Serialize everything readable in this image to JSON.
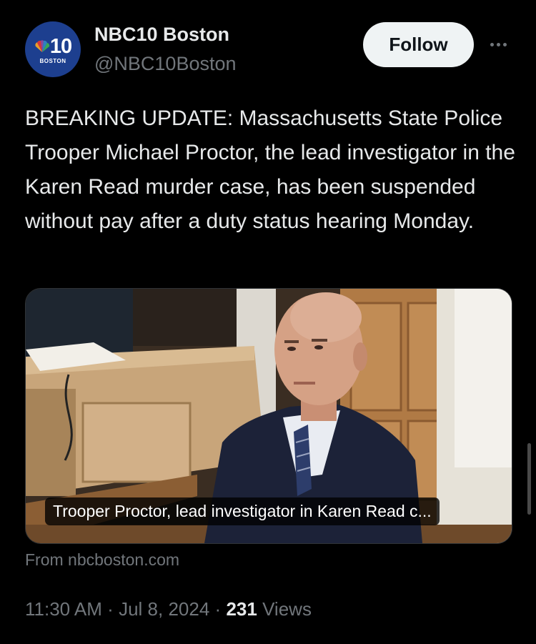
{
  "author": {
    "name": "NBC10 Boston",
    "handle": "@NBC10Boston",
    "avatar": {
      "logo_number": "10",
      "logo_city": "BOSTON",
      "icon": "peacock-icon",
      "bg_color": "#1d3f8f"
    }
  },
  "follow_button": {
    "label": "Follow"
  },
  "more_button": {
    "icon": "ellipsis-icon"
  },
  "tweet": {
    "text": "BREAKING UPDATE: Massachusetts State Police Trooper Michael Proctor, the lead investigator in the Karen Read murder case, has been suspended without pay after a duty status hearing Monday."
  },
  "media": {
    "caption": "Trooper Proctor, lead investigator in Karen Read c...",
    "source": "From nbcboston.com"
  },
  "meta": {
    "time": "11:30 AM",
    "separator": "·",
    "date": "Jul 8, 2024",
    "views_count": "231",
    "views_label": "Views"
  },
  "colors": {
    "background": "#000000",
    "text": "#e7e9ea",
    "secondary": "#71767b"
  }
}
